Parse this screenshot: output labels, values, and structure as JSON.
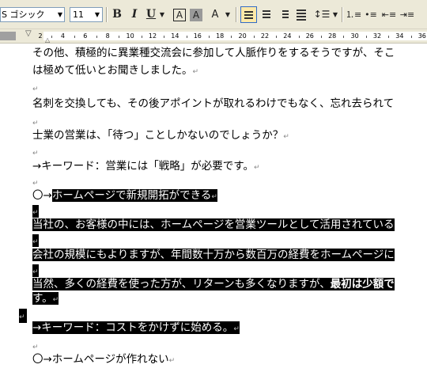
{
  "toolbar": {
    "font_name": "S ゴシック",
    "font_size": "11",
    "bold_label": "B",
    "italic_label": "I",
    "underline_label": "U",
    "char_border_label": "A",
    "char_shade_label": "A",
    "phonetic_label": "A",
    "icons": [
      "font-name-dropdown-icon",
      "font-size-dropdown-icon",
      "bold-icon",
      "italic-icon",
      "underline-icon",
      "character-border-icon",
      "character-shading-icon",
      "phonetic-guide-icon",
      "align-justify-icon",
      "align-center-icon",
      "align-right-icon",
      "distributed-icon",
      "line-spacing-icon",
      "numbering-icon",
      "bullets-icon",
      "decrease-indent-icon",
      "increase-indent-icon"
    ]
  },
  "ruler": {
    "ticks": [
      "2",
      "4",
      "6",
      "8",
      "10",
      "12",
      "14",
      "16",
      "18",
      "20",
      "22",
      "24",
      "26",
      "28",
      "30",
      "32",
      "34",
      "36"
    ]
  },
  "document": {
    "paragraph_mark": "↵",
    "lines": [
      {
        "text": "その他、積極的に異業種交流会に参加して人脈作りをするそうですが、そこ",
        "mark": false,
        "hl": false
      },
      {
        "text": "は極めて低いとお聞きしました。",
        "mark": true,
        "hl": false
      },
      {
        "text": "",
        "mark": true,
        "hl": false
      },
      {
        "text": "名刺を交換しても、その後アポイントが取れるわけでもなく、忘れ去られて",
        "mark": false,
        "hl": false
      },
      {
        "text": "",
        "mark": true,
        "hl": false
      },
      {
        "text": "士業の営業は、「待つ」ことしかないのでしょうか？",
        "mark": true,
        "hl": false
      },
      {
        "text": "",
        "mark": true,
        "hl": false
      },
      {
        "text": "→キーワード：営業には「戦略」が必要です。",
        "mark": true,
        "hl": false
      },
      {
        "text": "",
        "mark": true,
        "hl": false
      },
      {
        "text": "ホームページで新規開拓ができる",
        "prefix": "〇→",
        "mark": true,
        "hl": "partial"
      },
      {
        "text": "",
        "mark": true,
        "hl": "mark"
      },
      {
        "text": "当社の、お客様の中には、ホームページを営業ツールとして活用されている",
        "mark": false,
        "hl": true
      },
      {
        "text": "",
        "mark": true,
        "hl": "mark"
      },
      {
        "text": "会社の規模にもよりますが、年間数十万から数百万の経費をホームページに",
        "mark": false,
        "hl": true
      },
      {
        "text": "",
        "mark": true,
        "hl": "mark"
      },
      {
        "text": "当然、多くの経費を使った方が、リターンも多くなりますが、",
        "bold_tail": "最初は少額で",
        "mark": false,
        "hl": true
      },
      {
        "text": "す。",
        "mark": true,
        "hl": true
      },
      {
        "text": "",
        "mark": true,
        "hl": "outdent"
      },
      {
        "text": "→キーワード：コストをかけずに始める。",
        "mark": true,
        "hl": true
      },
      {
        "text": "",
        "mark": true,
        "hl": false
      },
      {
        "text": "〇→ホームページが作れない",
        "mark": true,
        "hl": false
      }
    ]
  }
}
